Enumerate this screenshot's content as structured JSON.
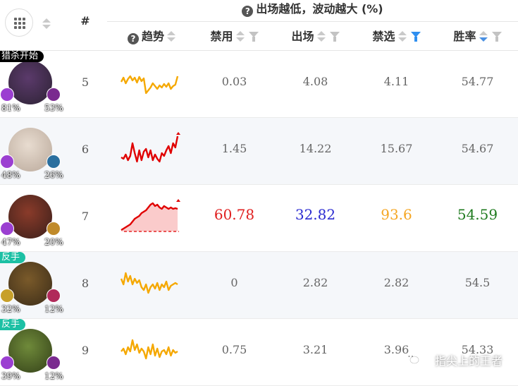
{
  "header": {
    "group_title": "出场越低，波动越大 (%)",
    "rank_label": "#",
    "columns": {
      "trend": "趋势",
      "ban": "禁用",
      "appear": "出场",
      "bp": "禁选",
      "winrate": "胜率"
    },
    "help_glyph": "?"
  },
  "colors": {
    "ban_highlight": "#e02020",
    "appear_highlight": "#2b2bd1",
    "bp_highlight": "#f5a623",
    "win_highlight": "#1e7a1e",
    "spark_orange": "#f5a800",
    "spark_red": "#e00000",
    "filter_active": "#2f8ff0"
  },
  "rows": [
    {
      "rank": "5",
      "tag": "猎杀开始",
      "tag_style": "black",
      "left_pct": "81%",
      "right_pct": "53%",
      "ban": "0.03",
      "appear": "4.08",
      "bp": "4.11",
      "winrate": "54.77",
      "trend_color": "orange",
      "trend": [
        28,
        22,
        30,
        24,
        20,
        26,
        22,
        29,
        21,
        27,
        23,
        44,
        40,
        36,
        30,
        34,
        38,
        33,
        36,
        31,
        35,
        30,
        38,
        34,
        32,
        20
      ]
    },
    {
      "rank": "6",
      "tag": "",
      "tag_style": "",
      "left_pct": "48%",
      "right_pct": "26%",
      "ban": "1.45",
      "appear": "14.22",
      "bp": "15.67",
      "winrate": "54.67",
      "trend_color": "red",
      "trend": [
        40,
        42,
        36,
        44,
        38,
        20,
        34,
        46,
        30,
        44,
        32,
        28,
        40,
        30,
        44,
        36,
        42,
        46,
        34,
        38,
        30,
        24,
        34,
        20,
        26,
        10
      ]
    },
    {
      "rank": "7",
      "tag": "",
      "tag_style": "",
      "left_pct": "47%",
      "right_pct": "20%",
      "ban": "60.78",
      "appear": "32.82",
      "bp": "93.6",
      "winrate": "54.59",
      "trend_color": "red",
      "highlight": true,
      "trend": [
        48,
        46,
        44,
        42,
        40,
        36,
        32,
        30,
        28,
        24,
        22,
        20,
        16,
        12,
        10,
        14,
        12,
        16,
        18,
        14,
        16,
        18,
        16,
        18,
        17,
        18
      ]
    },
    {
      "rank": "8",
      "tag": "反手",
      "tag_style": "teal",
      "left_pct": "32%",
      "right_pct": "12%",
      "ban": "0",
      "appear": "2.82",
      "bp": "2.82",
      "winrate": "54.5",
      "trend_color": "orange",
      "trend": [
        22,
        30,
        14,
        26,
        18,
        30,
        22,
        28,
        24,
        34,
        38,
        30,
        42,
        34,
        30,
        36,
        28,
        38,
        30,
        34,
        26,
        38,
        32,
        30,
        28,
        30
      ]
    },
    {
      "rank": "9",
      "tag": "反手",
      "tag_style": "teal",
      "left_pct": "39%",
      "right_pct": "12%",
      "ban": "0.75",
      "appear": "3.21",
      "bp": "3.96",
      "winrate": "54.33",
      "trend_color": "orange",
      "trend": [
        30,
        26,
        34,
        24,
        30,
        14,
        28,
        20,
        32,
        26,
        30,
        40,
        24,
        34,
        20,
        36,
        26,
        38,
        30,
        28,
        34,
        24,
        36,
        28,
        32,
        30
      ]
    }
  ],
  "watermark": "指尖上的王者"
}
